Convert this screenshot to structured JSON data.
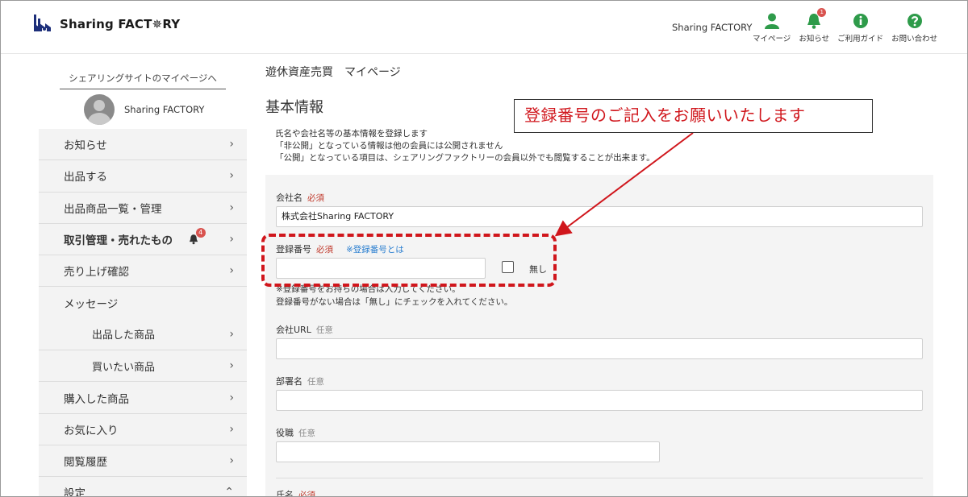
{
  "header": {
    "logo_text": "Sharing FACT✵RY",
    "user_name": "Sharing FACTORY",
    "nav": [
      {
        "label": "マイページ",
        "icon": "user-icon",
        "color": "#2e9b4a"
      },
      {
        "label": "お知らせ",
        "icon": "bell-icon",
        "color": "#2e9b4a",
        "badge": "1"
      },
      {
        "label": "ご利用ガイド",
        "icon": "info-icon",
        "color": "#2e9b4a"
      },
      {
        "label": "お問い合わせ",
        "icon": "question-icon",
        "color": "#2e9b4a"
      }
    ]
  },
  "sidebar": {
    "top_link": "シェアリングサイトのマイページへ",
    "profile_name": "Sharing FACTORY",
    "items": [
      {
        "label": "お知らせ"
      },
      {
        "label": "出品する"
      },
      {
        "label": "出品商品一覧・管理"
      },
      {
        "label": "取引管理・売れたもの",
        "badge": "4"
      },
      {
        "label": "売り上げ確認"
      },
      {
        "label": "メッセージ"
      },
      {
        "label": "出品した商品"
      },
      {
        "label": "買いたい商品"
      },
      {
        "label": "購入した商品"
      },
      {
        "label": "お気に入り"
      },
      {
        "label": "閲覧履歴"
      },
      {
        "label": "設定"
      }
    ]
  },
  "main": {
    "breadcrumb": "遊休資産売買　マイページ",
    "title": "基本情報",
    "intro": [
      "氏名や会社名等の基本情報を登録します",
      "「非公開」となっている情報は他の会員には公開されません",
      "「公開」となっている項目は、シェアリングファクトリーの会員以外でも閲覧することが出来ます。"
    ],
    "fields": {
      "company": {
        "label": "会社名",
        "required": "必須",
        "value": "株式会社Sharing FACTORY"
      },
      "reg_no": {
        "label": "登録番号",
        "required": "必須",
        "link": "※登録番号とは",
        "value": "",
        "checkbox_label": "無し",
        "note1": "※登録番号をお持ちの場合は入力してください。",
        "note2": "登録番号がない場合は「無し」にチェックを入れてください。"
      },
      "url": {
        "label": "会社URL",
        "optional": "任意",
        "value": ""
      },
      "dept": {
        "label": "部署名",
        "optional": "任意",
        "value": ""
      },
      "position": {
        "label": "役職",
        "optional": "任意",
        "value": ""
      },
      "name": {
        "label": "氏名",
        "required": "必須"
      }
    }
  },
  "annotation": {
    "callout": "登録番号のご記入をお願いいたします",
    "color": "#d0161c"
  }
}
